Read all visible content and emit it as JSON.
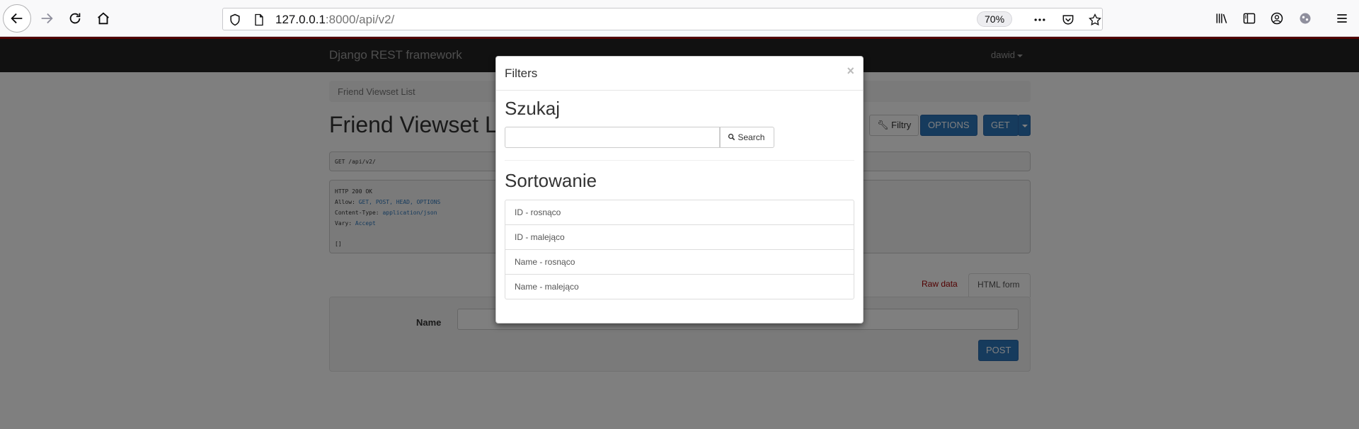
{
  "browser": {
    "url_host": "127.0.0.1",
    "url_rest": ":8000/api/v2/",
    "zoom": "70%"
  },
  "page": {
    "brand": "Django REST framework",
    "user": "dawid",
    "breadcrumb": "Friend Viewset List",
    "title": "Friend Viewset List",
    "buttons": {
      "filters": "Filtry",
      "options": "OPTIONS",
      "get": "GET"
    },
    "request_line": "GET /api/v2/",
    "response": {
      "status": "HTTP 200 OK",
      "allow_key": "Allow:",
      "allow_value": "GET, POST, HEAD, OPTIONS",
      "content_type_key": "Content-Type:",
      "content_type_value": "application/json",
      "vary_key": "Vary:",
      "vary_value": "Accept",
      "body": "[]"
    },
    "tabs": {
      "raw": "Raw data",
      "html": "HTML form"
    },
    "form": {
      "name_label": "Name",
      "post_button": "POST"
    }
  },
  "modal": {
    "title": "Filters",
    "close": "×",
    "search_heading": "Szukaj",
    "search_button": "Search",
    "search_value": "",
    "sort_heading": "Sortowanie",
    "sort_options": [
      "ID - rosnąco",
      "ID - malejąco",
      "Name - rosnąco",
      "Name - malejąco"
    ]
  }
}
